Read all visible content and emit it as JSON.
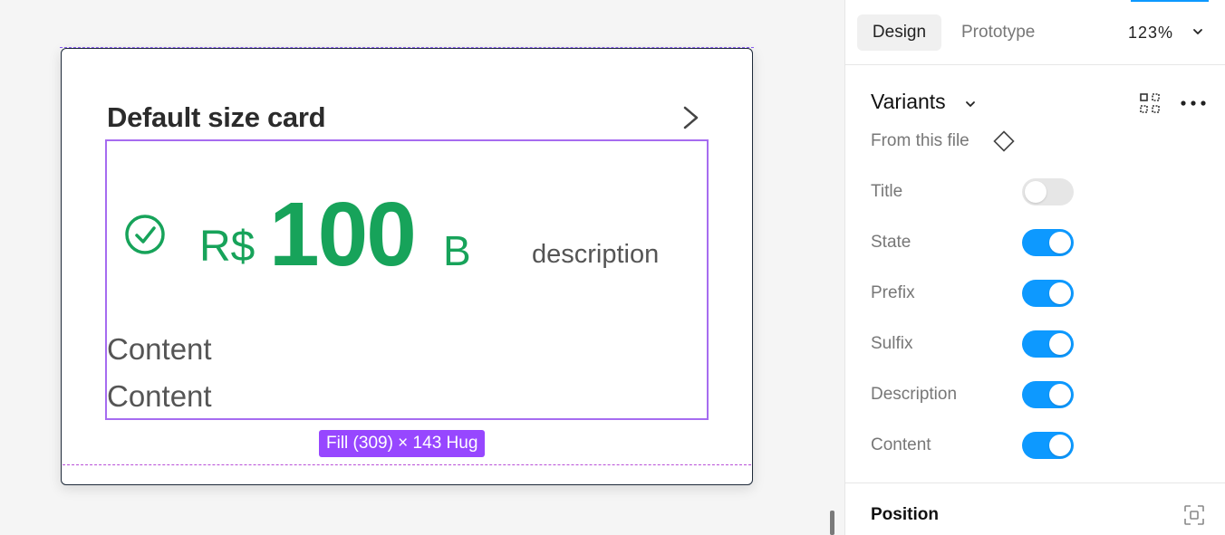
{
  "canvas": {
    "card": {
      "title": "Default size card",
      "prefix": "R$",
      "value": "100",
      "suffix": "B",
      "description": "description",
      "content": [
        "Content",
        "Content"
      ]
    },
    "size_badge": "Fill (309) × 143 Hug"
  },
  "panel": {
    "tabs": [
      {
        "label": "Design",
        "active": true
      },
      {
        "label": "Prototype",
        "active": false
      }
    ],
    "zoom": "123%",
    "variants_title": "Variants",
    "source": "From this file",
    "properties": [
      {
        "label": "Title",
        "on": false
      },
      {
        "label": "State",
        "on": true
      },
      {
        "label": "Prefix",
        "on": true
      },
      {
        "label": "Sulfix",
        "on": true
      },
      {
        "label": "Description",
        "on": true
      },
      {
        "label": "Content",
        "on": true
      }
    ],
    "position_title": "Position"
  },
  "colors": {
    "accent": "#0d99ff",
    "selection": "#9747ff",
    "value_green": "#17a35a"
  },
  "icons": [
    "chevron-right-icon",
    "check-circle-icon",
    "chevron-down-icon",
    "component-grid-icon",
    "more-icon",
    "diamond-icon",
    "fit-frame-icon"
  ]
}
